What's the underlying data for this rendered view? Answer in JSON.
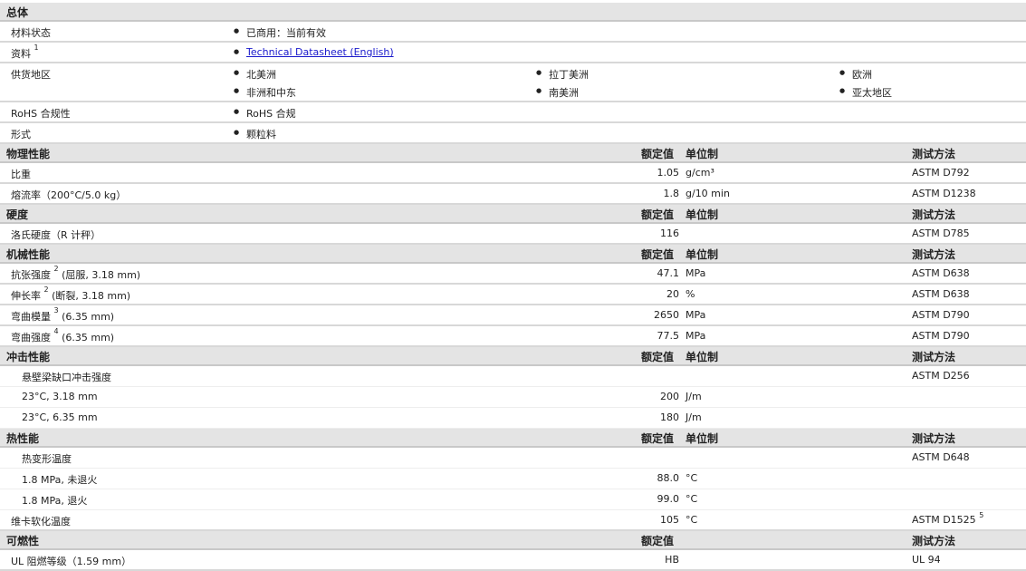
{
  "general": {
    "title": "总体",
    "rows": [
      {
        "label": "材料状态",
        "items": [
          "已商用：当前有效"
        ]
      },
      {
        "label": "资料",
        "sup": "1",
        "link": "Technical Datasheet (English)"
      },
      {
        "label": "供货地区",
        "items": [
          "北美洲",
          "拉丁美洲",
          "欧洲",
          "非洲和中东",
          "南美洲",
          "亚太地区"
        ]
      },
      {
        "label": "RoHS 合规性",
        "items": [
          "RoHS 合规"
        ]
      },
      {
        "label": "形式",
        "items": [
          "颗粒料"
        ]
      }
    ]
  },
  "sections": [
    {
      "title": "物理性能",
      "value_hdr": "额定值",
      "unit_hdr": "单位制",
      "method_hdr": "测试方法",
      "rows": [
        {
          "label": "比重",
          "value": "1.05",
          "unit": "g/cm³",
          "method": "ASTM D792"
        },
        {
          "label": "熔流率（200°C/5.0 kg）",
          "value": "1.8",
          "unit": "g/10 min",
          "method": "ASTM D1238"
        }
      ]
    },
    {
      "title": "硬度",
      "value_hdr": "额定值",
      "unit_hdr": "单位制",
      "method_hdr": "测试方法",
      "rows": [
        {
          "label": "洛氏硬度（R 计秤）",
          "value": "116",
          "unit": "",
          "method": "ASTM D785"
        }
      ]
    },
    {
      "title": "机械性能",
      "value_hdr": "额定值",
      "unit_hdr": "单位制",
      "method_hdr": "测试方法",
      "rows": [
        {
          "label": "抗张强度",
          "sup": "2",
          "note": " (屈服, 3.18 mm)",
          "value": "47.1",
          "unit": "MPa",
          "method": "ASTM D638"
        },
        {
          "label": "伸长率",
          "sup": "2",
          "note": " (断裂, 3.18 mm)",
          "value": "20",
          "unit": "%",
          "method": "ASTM D638"
        },
        {
          "label": "弯曲模量",
          "sup": "3",
          "note": " (6.35 mm)",
          "value": "2650",
          "unit": "MPa",
          "method": "ASTM D790"
        },
        {
          "label": "弯曲强度",
          "sup": "4",
          "note": " (6.35 mm)",
          "value": "77.5",
          "unit": "MPa",
          "method": "ASTM D790"
        }
      ]
    },
    {
      "title": "冲击性能",
      "value_hdr": "额定值",
      "unit_hdr": "单位制",
      "method_hdr": "测试方法",
      "rows": [
        {
          "label": "悬壁梁缺口冲击强度",
          "value": "",
          "unit": "",
          "method": "ASTM D256",
          "group": true
        },
        {
          "label": "23°C, 3.18 mm",
          "value": "200",
          "unit": "J/m",
          "method": "",
          "sub": true
        },
        {
          "label": "23°C, 6.35 mm",
          "value": "180",
          "unit": "J/m",
          "method": "",
          "sub": true
        }
      ]
    },
    {
      "title": "热性能",
      "value_hdr": "额定值",
      "unit_hdr": "单位制",
      "method_hdr": "测试方法",
      "rows": [
        {
          "label": "热变形温度",
          "value": "",
          "unit": "",
          "method": "ASTM D648",
          "group": true
        },
        {
          "label": "1.8 MPa, 未退火",
          "value": "88.0",
          "unit": "°C",
          "method": "",
          "sub": true
        },
        {
          "label": "1.8 MPa, 退火",
          "value": "99.0",
          "unit": "°C",
          "method": "",
          "sub": true
        },
        {
          "label": "维卡软化温度",
          "value": "105",
          "unit": "°C",
          "method": "ASTM D1525",
          "method_sup": "5"
        }
      ]
    },
    {
      "title": "可燃性",
      "value_hdr": "额定值",
      "unit_hdr": "",
      "method_hdr": "测试方法",
      "rows": [
        {
          "label": "UL 阻燃等级（1.59 mm）",
          "value": "HB",
          "unit": "",
          "method": "UL 94"
        }
      ]
    }
  ]
}
